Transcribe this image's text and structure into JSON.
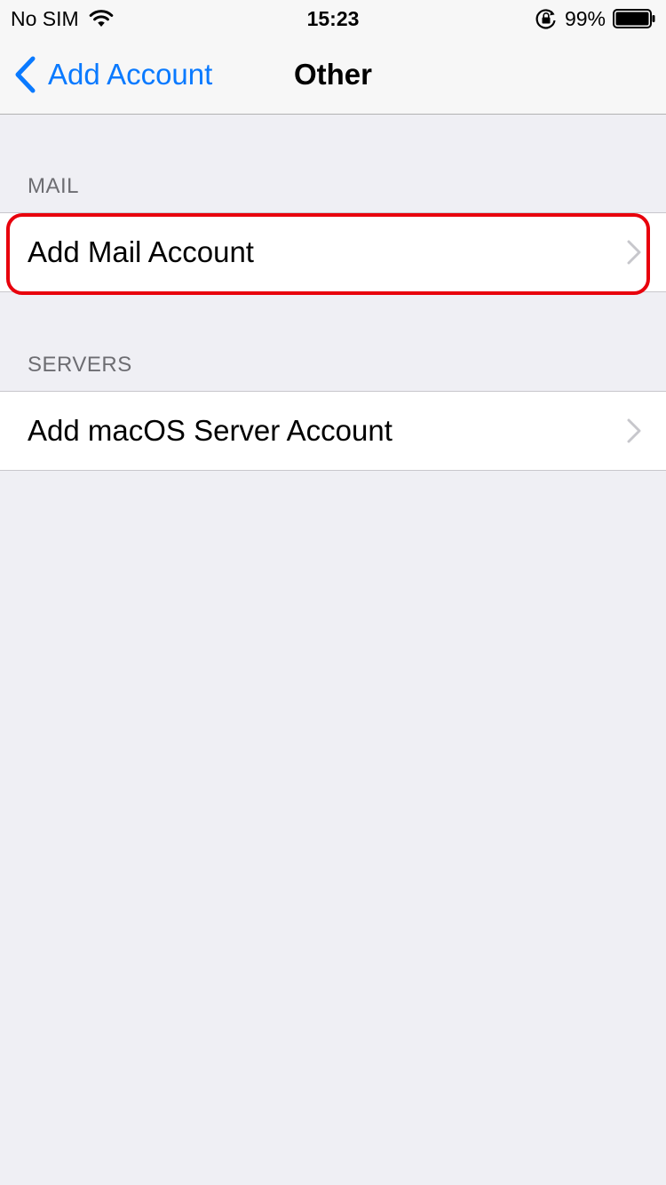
{
  "status_bar": {
    "carrier": "No SIM",
    "time": "15:23",
    "battery_percent": "99%",
    "icons": [
      "wifi-icon",
      "lock-rotation-icon",
      "battery-icon"
    ]
  },
  "nav": {
    "back_label": "Add Account",
    "title": "Other",
    "accent_color": "#0a7aff"
  },
  "sections": [
    {
      "header": "MAIL",
      "items": [
        {
          "label": "Add Mail Account",
          "highlighted": true
        }
      ]
    },
    {
      "header": "SERVERS",
      "items": [
        {
          "label": "Add macOS Server Account",
          "highlighted": false
        }
      ]
    }
  ],
  "colors": {
    "background": "#efeff4",
    "highlight": "#e8000c"
  }
}
